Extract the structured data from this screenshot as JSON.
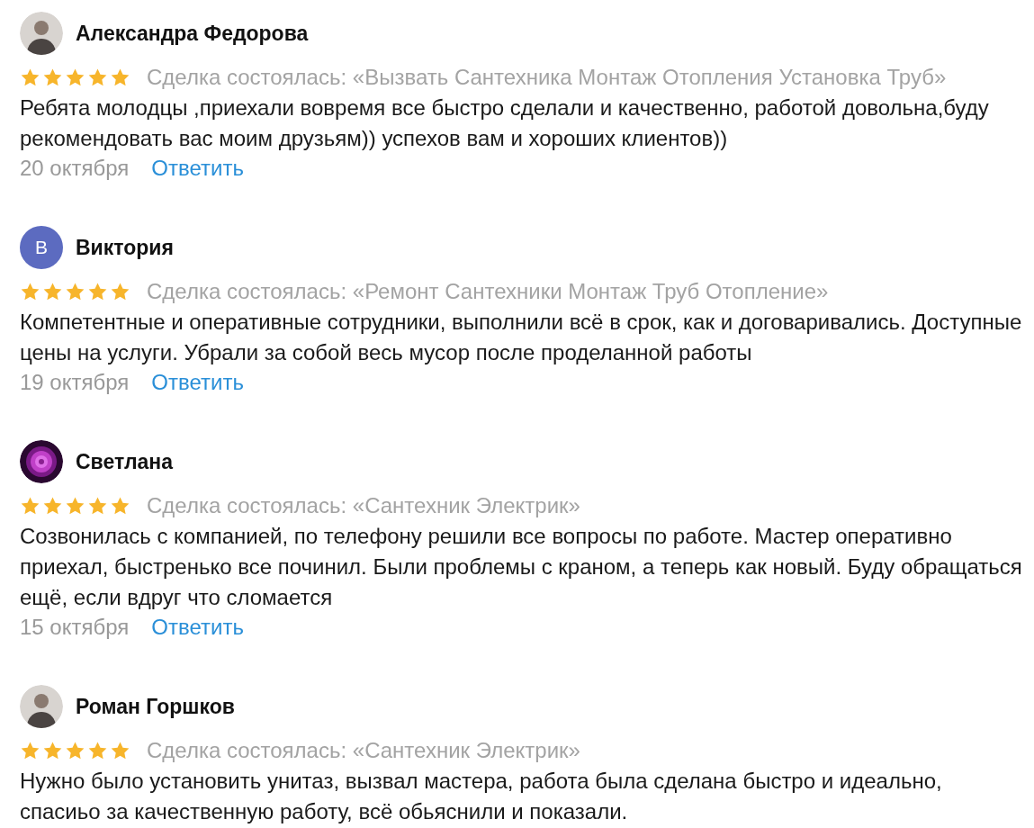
{
  "reviews": [
    {
      "author": "Александра Федорова",
      "stars": 5,
      "deal": "Сделка состоялась: «Вызвать Сантехника Монтаж Отопления Установка Труб»",
      "text": "Ребята молодцы ,приехали вовремя все быстро сделали и качественно, работой довольна,буду рекомендовать вас моим друзьям)) успехов вам и хороших клиентов))",
      "date": "20 октября",
      "reply": "Ответить"
    },
    {
      "author": "Виктория",
      "avatar": {
        "kind": "letter",
        "letter": "В",
        "color": "#5c6bc0"
      },
      "stars": 5,
      "deal": "Сделка состоялась: «Ремонт Сантехники Монтаж Труб Отопление»",
      "text": "Компетентные и оперативные сотрудники, выполнили всё в срок, как и договаривались. Доступные цены на услуги. Убрали за собой весь мусор после проделанной работы",
      "date": "19 октября",
      "reply": "Ответить"
    },
    {
      "author": "Светлана",
      "stars": 5,
      "deal": "Сделка состоялась: «Сантехник Электрик»",
      "text": "Созвонилась с компанией, по телефону решили все вопросы по работе. Мастер оперативно приехал, быстренько все починил. Были проблемы с краном, а теперь как новый. Буду обращаться ещё, если вдруг что сломается",
      "date": "15 октября",
      "reply": "Ответить"
    },
    {
      "author": "Роман Горшков",
      "stars": 5,
      "deal": "Сделка состоялась: «Сантехник Электрик»",
      "text": "Нужно было установить унитаз, вызвал мастера, работа была сделана быстро и идеально, спасиьо за качественную работу, всё обьяснили и показали."
    }
  ]
}
